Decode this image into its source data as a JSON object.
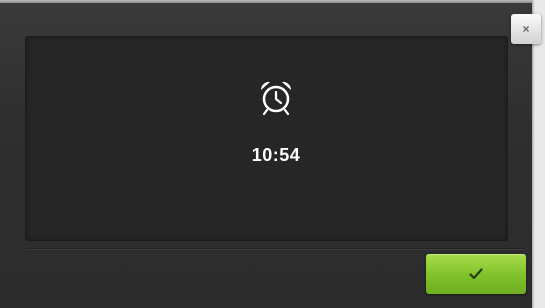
{
  "dialog": {
    "alarm_time": "10:54",
    "alarm_icon": "alarm-clock-icon",
    "close_label": "×",
    "confirm_icon": "checkmark-icon"
  },
  "colors": {
    "dialog_background": "#2f2f2f",
    "panel_background": "#262626",
    "confirm_green": "#7fc22a",
    "text": "#ffffff"
  }
}
